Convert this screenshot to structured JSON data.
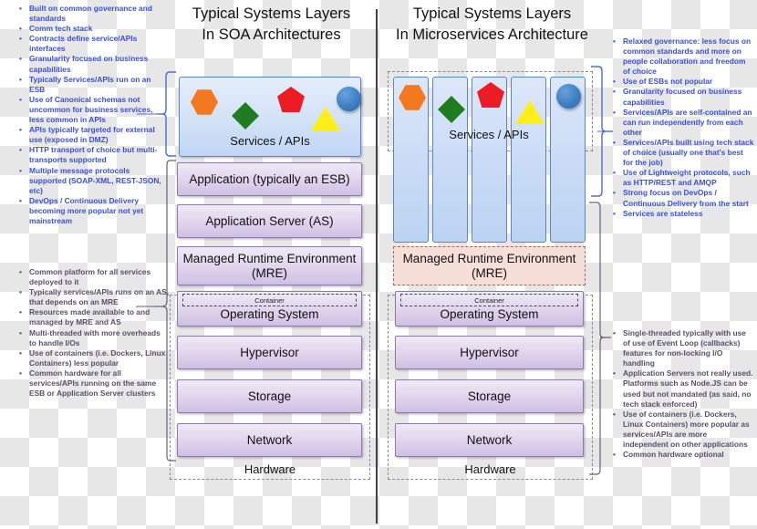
{
  "soa": {
    "title_line1": "Typical Systems Layers",
    "title_line2": "In SOA Architectures",
    "services_label": "Services / APIs",
    "layers": [
      "Application (typically an ESB)",
      "Application Server (AS)",
      "Managed Runtime Environment (MRE)",
      "Operating System",
      "Hypervisor",
      "Storage",
      "Network"
    ],
    "container_label": "Container",
    "hardware_label": "Hardware",
    "notes_top": [
      "Built on common governance and standards",
      "Comm tech stack",
      "Contracts define service/APIs interfaces",
      "Granularity focused on business capabilities",
      "Typically Services/APIs run on an ESB",
      "Use of Canonical schemas not uncommon for business services, less common in APIs",
      "APIs typically targeted for external use (exposed in DMZ)",
      "HTTP transport of choice but multi-transports supported",
      "Multiple message protocols supported (SOAP-XML, REST-JSON, etc)",
      "DevOps / Continuous Delivery becoming more popular not yet mainstream"
    ],
    "notes_bottom": [
      "Common platform for all services deployed to it",
      "Typically services/APIs runs on an AS, that depends on an MRE",
      "Resources made available to and managed by MRE and AS",
      "Multi-threaded with more overheads to handle I/Os",
      "Use of containers (i.e. Dockers, Linux Containers) less popular",
      "Common hardware for all services/APIs running on the same ESB or Application Server clusters"
    ]
  },
  "microservices": {
    "title_line1": "Typical Systems Layers",
    "title_line2": "In Microservices Architecture",
    "services_label": "Services / APIs",
    "mre_label": "Managed Runtime Environment (MRE)",
    "layers": [
      "Operating System",
      "Hypervisor",
      "Storage",
      "Network"
    ],
    "container_label": "Container",
    "hardware_label": "Hardware",
    "notes_top": [
      "Relaxed governance: less focus on common standards and more on people collaboration and freedom of choice",
      "Use of ESBs not popular",
      "Granularity focused on business capabilities",
      "Services/APIs are self-contained an can run independently from each other",
      "Services/APIs built using tech stack of choice (usually one that's best for the job)",
      "Use of Lightweight protocols, such as HTTP/REST and AMQP",
      "Strong focus on DevOps / Continuous Delivery from the start",
      "Services are stateless"
    ],
    "notes_bottom": [
      "Single-threaded typically with use of use of Event Loop (callbacks) features for non-locking I/O handling",
      "Application Servers not really used. Platforms such as Node.JS can be used but not mandated (as said, no tech stack enforced)",
      "Use of containers (i.e. Dockers, Linux Containers) more popular as services/APIs are more independent on other applications",
      "Common hardware optional"
    ]
  },
  "shapes": [
    {
      "name": "hexagon",
      "color": "#f4781f"
    },
    {
      "name": "diamond",
      "color": "#1f7d1f"
    },
    {
      "name": "pentagon",
      "color": "#ec1c24"
    },
    {
      "name": "triangle",
      "color": "#ffee1a"
    },
    {
      "name": "circle",
      "color": "#3d7fc0"
    }
  ],
  "bullet_glyph": "•",
  "colors": {
    "note_blue": "#3a4fd8",
    "note_purple": "#58506b",
    "layer_purple": "#cfc0e3",
    "service_blue": "#bed6f3",
    "mre_pink": "#f6dfd8",
    "divider": "#3f3f46"
  }
}
